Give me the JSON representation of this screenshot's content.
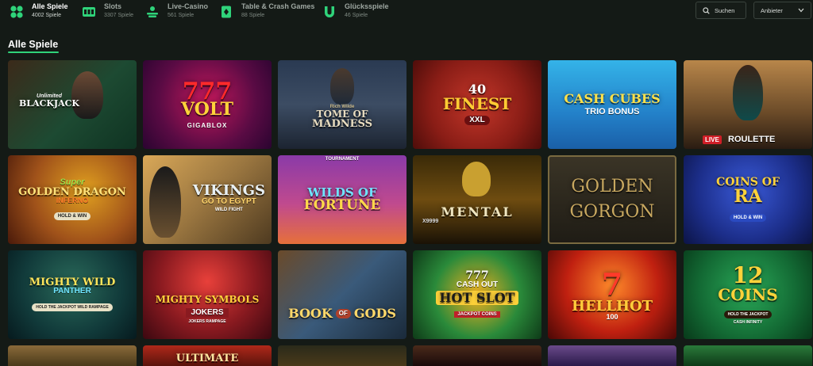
{
  "topnav": {
    "categories": [
      {
        "name": "Alle Spiele",
        "count": "4002 Spiele",
        "active": true
      },
      {
        "name": "Slots",
        "count": "3307 Spiele",
        "active": false
      },
      {
        "name": "Live-Casino",
        "count": "561 Spiele",
        "active": false
      },
      {
        "name": "Table & Crash Games",
        "count": "88 Spiele",
        "active": false
      },
      {
        "name": "Glücksspiele",
        "count": "46 Spiele",
        "active": false
      }
    ],
    "search_label": "Suchen",
    "provider_label": "Anbieter"
  },
  "section": {
    "title": "Alle Spiele"
  },
  "colors": {
    "accent": "#2fd37a",
    "background": "#141a16"
  },
  "games": [
    {
      "title": "Unlimited Blackjack",
      "line1": "Unlimited",
      "line2": "BLACKJACK"
    },
    {
      "title": "777 Volt",
      "line1": "777",
      "line2": "VOLT",
      "line3": "GIGABLOX"
    },
    {
      "title": "Tome of Madness",
      "line1": "TOME OF",
      "line2": "MADNESS",
      "line3": "Rich Wilde"
    },
    {
      "title": "40 Finest XXL",
      "line1": "40",
      "line2": "FINEST",
      "line3": "XXL"
    },
    {
      "title": "Cash Cubes Trio Bonus",
      "line1": "CASH CUBES",
      "line2": "TRIO BONUS"
    },
    {
      "title": "Live Roulette",
      "line1": "LIVE",
      "line2": "ROULETTE"
    },
    {
      "title": "Super Golden Dragon Inferno",
      "line1": "Super",
      "line2": "GOLDEN DRAGON",
      "line3": "INFERNO",
      "line4": "HOLD & WIN"
    },
    {
      "title": "Vikings Go To Egypt Wild Fight",
      "line1": "VIKINGS",
      "line2": "GO TO EGYPT",
      "line3": "WILD FIGHT"
    },
    {
      "title": "Wilds of Fortune",
      "line1": "TOURNAMENT",
      "line2": "WILDS OF",
      "line3": "FORTUNE"
    },
    {
      "title": "Mental",
      "line1": "MENTAL",
      "line2": "X9999"
    },
    {
      "title": "Golden Gorgon",
      "line1": "GOLDEN",
      "line2": "GORGON"
    },
    {
      "title": "Coins of Ra",
      "line1": "COINS OF",
      "line2": "RA",
      "line3": "HOLD & WIN"
    },
    {
      "title": "Mighty Wild Panther",
      "line1": "MIGHTY WILD",
      "line2": "PANTHER",
      "line3": "HOLD THE JACKPOT WILD RAMPAGE"
    },
    {
      "title": "Mighty Symbols Jokers",
      "line1": "MIGHTY SYMBOLS",
      "line2": "JOKERS",
      "line3": "JOKERS RAMPAGE"
    },
    {
      "title": "Book of Gods",
      "line1": "BOOK",
      "line2": "OF",
      "line3": "GODS"
    },
    {
      "title": "777 Cash Out Hot Slot",
      "line1": "777",
      "line2": "CASH OUT",
      "line3": "HOT SLOT",
      "line4": "JACKPOT COINS"
    },
    {
      "title": "Hell Hot 100",
      "line1": "7",
      "line2": "HELLHOT",
      "line3": "100"
    },
    {
      "title": "12 Coins",
      "line1": "12",
      "line2": "COINS",
      "line3": "HOLD THE JACKPOT",
      "line4": "CASH INFINITY"
    },
    {
      "title": "Ultimate",
      "line1": "ULTIMATE"
    },
    {
      "title": "partial-tile-20"
    },
    {
      "title": "partial-tile-21"
    },
    {
      "title": "partial-tile-22"
    },
    {
      "title": "partial-tile-23"
    },
    {
      "title": "partial-tile-24"
    }
  ]
}
